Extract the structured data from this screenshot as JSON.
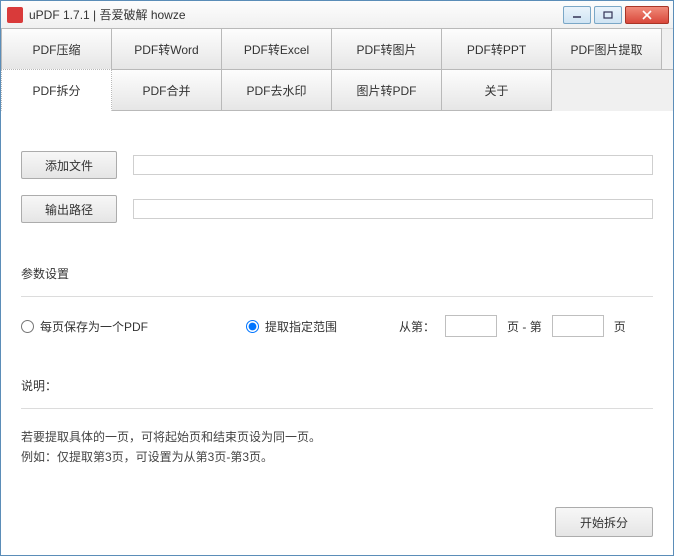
{
  "window": {
    "title": "uPDF 1.7.1 |  吾爱破解 howze"
  },
  "tabs_row1": [
    {
      "label": "PDF压缩"
    },
    {
      "label": "PDF转Word"
    },
    {
      "label": "PDF转Excel"
    },
    {
      "label": "PDF转图片"
    },
    {
      "label": "PDF转PPT"
    },
    {
      "label": "PDF图片提取"
    }
  ],
  "tabs_row2": [
    {
      "label": "PDF拆分",
      "active": true
    },
    {
      "label": "PDF合并"
    },
    {
      "label": "PDF去水印"
    },
    {
      "label": "图片转PDF"
    },
    {
      "label": "关于"
    }
  ],
  "buttons": {
    "add_file": "添加文件",
    "output_path": "输出路径",
    "start": "开始拆分"
  },
  "fields": {
    "add_file_value": "",
    "output_path_value": ""
  },
  "section": {
    "params_title": "参数设置",
    "desc_title": "说明："
  },
  "radio": {
    "opt_each_page": "每页保存为一个PDF",
    "opt_range": "提取指定范围",
    "selected": "range"
  },
  "range": {
    "from_label": "从第：",
    "from_value": "",
    "page_sep": "页  -  第",
    "to_value": "",
    "page_suffix": "页"
  },
  "desc": {
    "line1": "若要提取具体的一页，可将起始页和结束页设为同一页。",
    "line2": "例如：仅提取第3页，可设置为从第3页-第3页。"
  }
}
